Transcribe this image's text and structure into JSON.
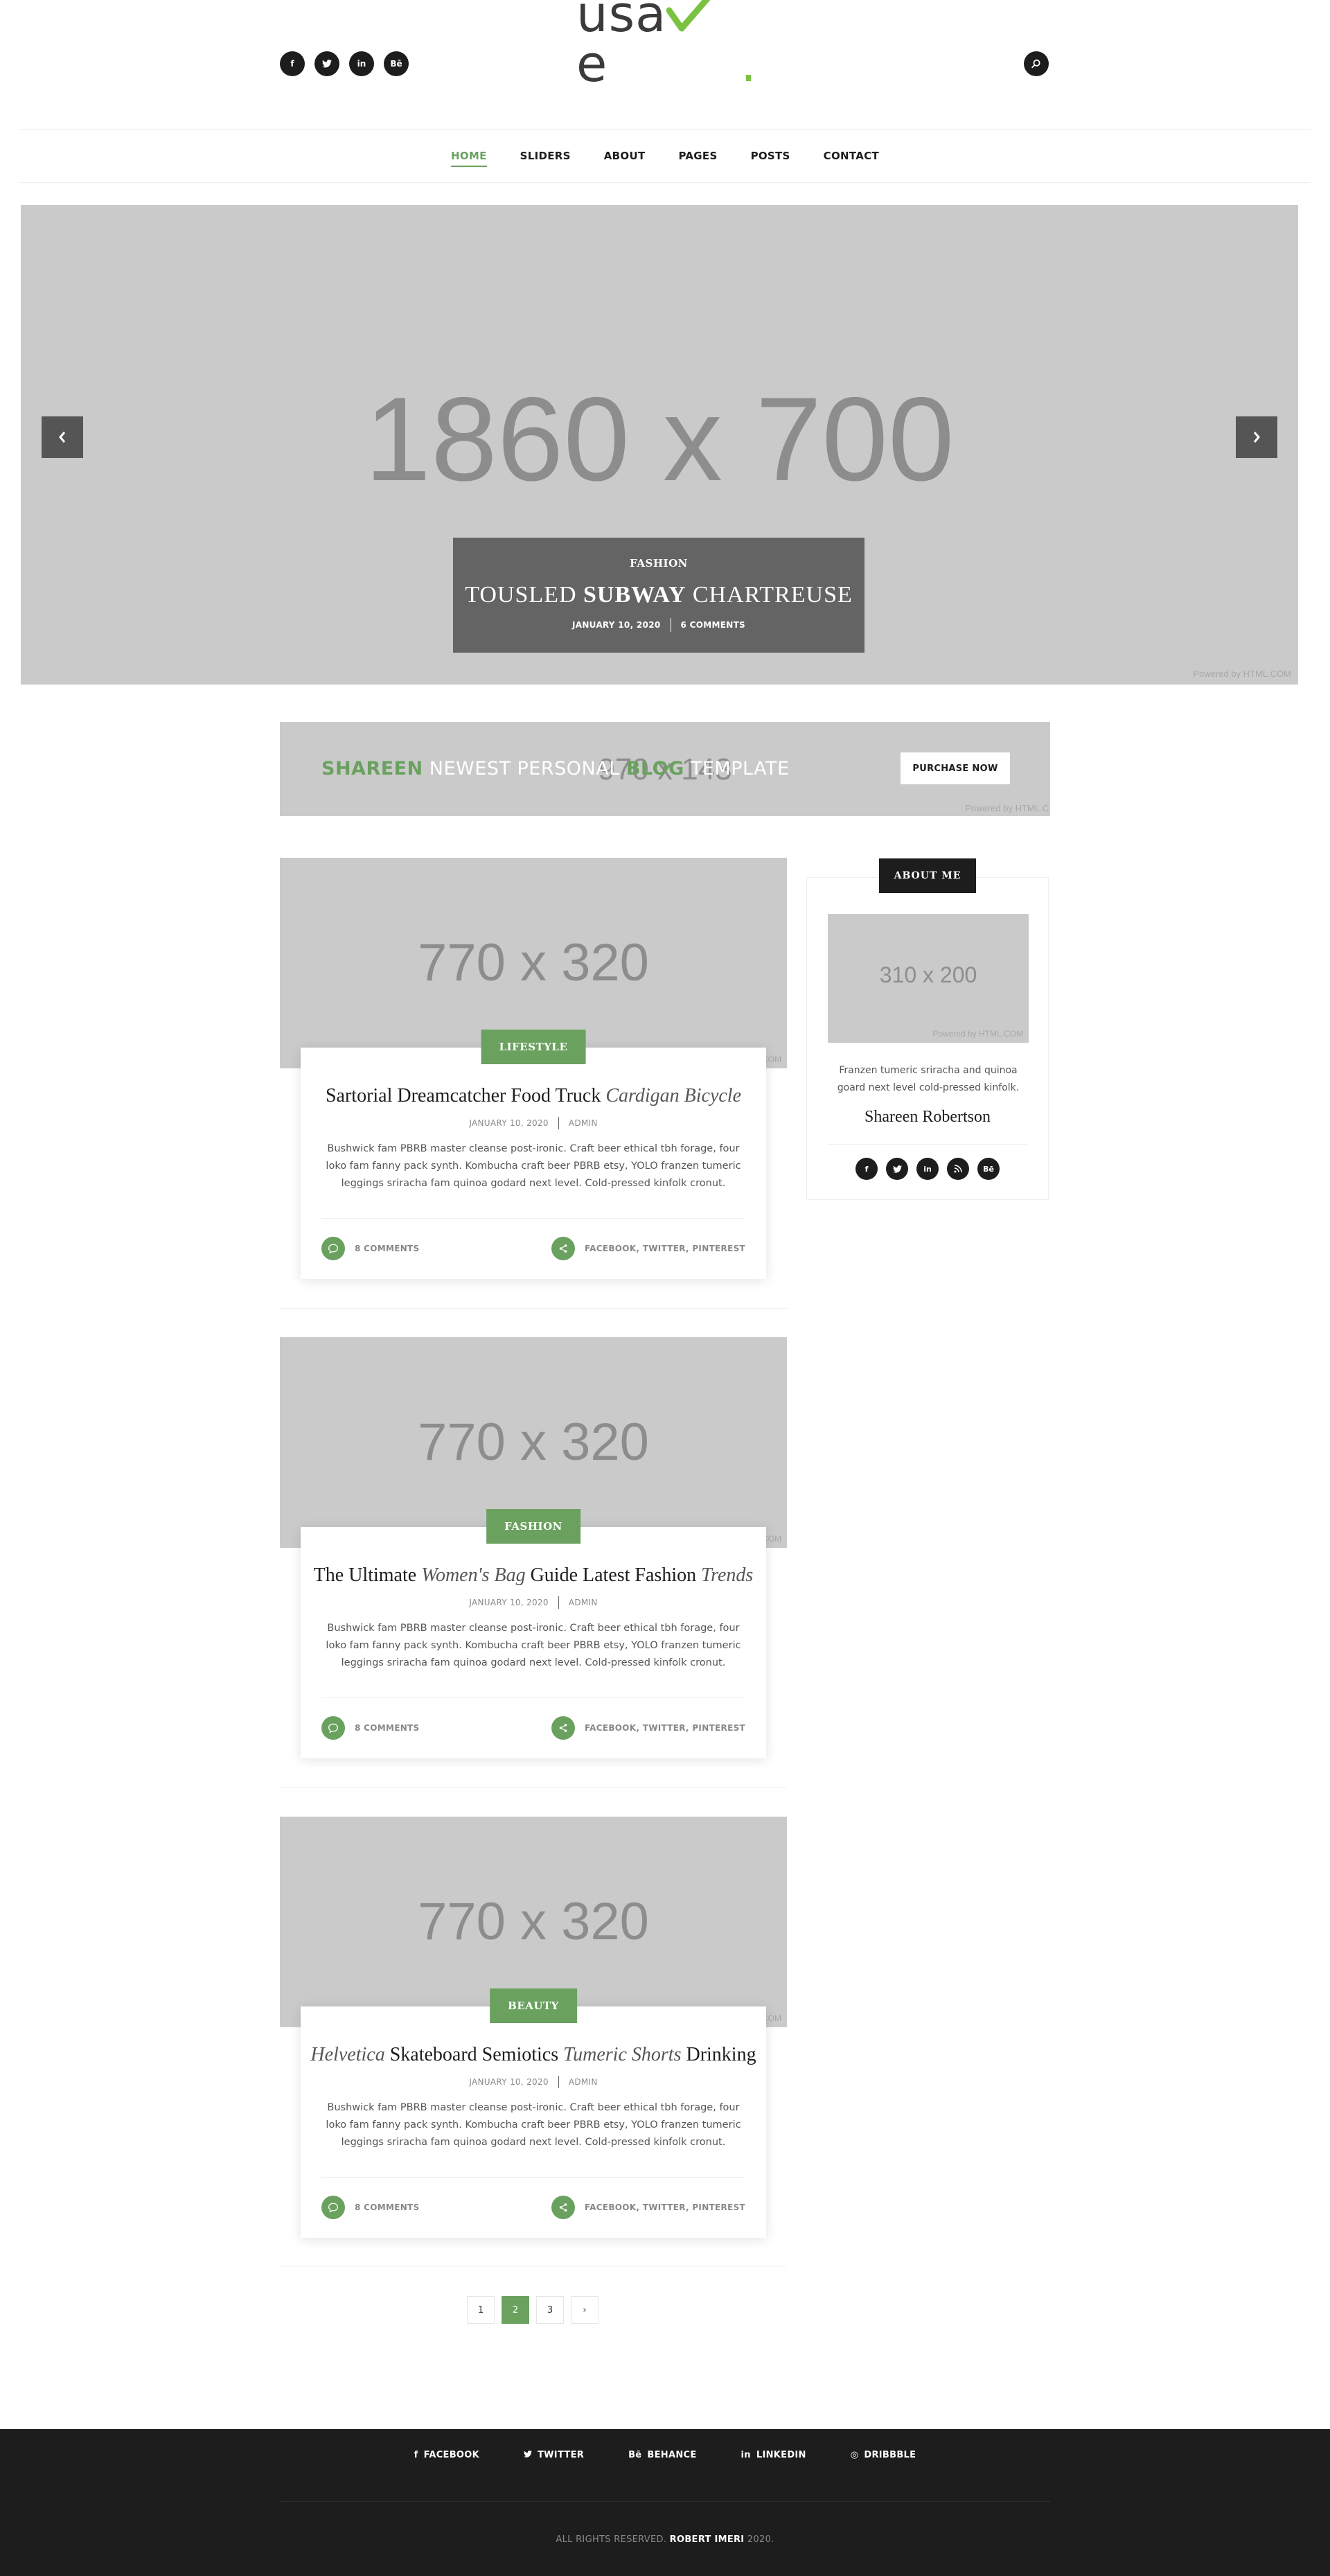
{
  "header": {
    "social": [
      "f",
      "t",
      "in",
      "Bē"
    ],
    "logo": {
      "part1": "usa",
      "check": "v",
      "part2": "e",
      "dot": "."
    },
    "search_icon": "search-icon"
  },
  "nav": {
    "items": [
      {
        "label": "HOME",
        "active": true
      },
      {
        "label": "SLIDERS",
        "active": false
      },
      {
        "label": "ABOUT",
        "active": false
      },
      {
        "label": "PAGES",
        "active": false
      },
      {
        "label": "POSTS",
        "active": false
      },
      {
        "label": "CONTACT",
        "active": false
      }
    ]
  },
  "hero": {
    "placeholder": "1860 x 700",
    "powered": "Powered by HTML.COM",
    "category": "FASHION",
    "title_a": "TOUSLED ",
    "title_b": "SUBWAY",
    "title_c": " CHARTREUSE",
    "date": "JANUARY 10, 2020",
    "comments": "6 COMMENTS"
  },
  "promo": {
    "placeholder": "970 x 143",
    "brand": "SHAREEN",
    "text_a": " NEWEST PERSONAL ",
    "blog": "BLOG",
    "text_b": " TEMPLATE",
    "button": "PURCHASE NOW",
    "powered": "Powered by HTML.C"
  },
  "posts": [
    {
      "placeholder": "770 x 320",
      "powered": "Powered by HTML.COM",
      "category": "LIFESTYLE",
      "title_a": "Sartorial Dreamcatcher Food Truck ",
      "title_i": "Cardigan Bicycle",
      "title_b": "",
      "date": "JANUARY 10, 2020",
      "author": "ADMIN",
      "excerpt": "Bushwick fam PBRB master cleanse post-ironic. Craft beer ethical tbh forage, four loko fam fanny pack synth. Kombucha craft beer PBRB etsy, YOLO franzen tumeric leggings sriracha fam quinoa godard next level. Cold-pressed kinfolk cronut.",
      "comments": "8 COMMENTS",
      "share": "FACEBOOK, TWITTER, PINTEREST"
    },
    {
      "placeholder": "770 x 320",
      "powered": "Powered by HTML.COM",
      "category": "FASHION",
      "title_a": "The Ultimate ",
      "title_i": "Women's Bag",
      "title_b": " Guide Latest Fashion ",
      "title_i2": "Trends",
      "date": "JANUARY 10, 2020",
      "author": "ADMIN",
      "excerpt": "Bushwick fam PBRB master cleanse post-ironic. Craft beer ethical tbh forage, four loko fam fanny pack synth. Kombucha craft beer PBRB etsy, YOLO franzen tumeric leggings sriracha fam quinoa godard next level. Cold-pressed kinfolk cronut.",
      "comments": "8 COMMENTS",
      "share": "FACEBOOK, TWITTER, PINTEREST"
    },
    {
      "placeholder": "770 x 320",
      "powered": "Powered by HTML.COM",
      "category": "BEAUTY",
      "title_i": "Helvetica",
      "title_a": " Skateboard Semiotics ",
      "title_i2": "Tumeric Shorts",
      "title_b": " Drinking",
      "date": "JANUARY 10, 2020",
      "author": "ADMIN",
      "excerpt": "Bushwick fam PBRB master cleanse post-ironic. Craft beer ethical tbh forage, four loko fam fanny pack synth. Kombucha craft beer PBRB etsy, YOLO franzen tumeric leggings sriracha fam quinoa godard next level. Cold-pressed kinfolk cronut.",
      "comments": "8 COMMENTS",
      "share": "FACEBOOK, TWITTER, PINTEREST"
    }
  ],
  "about": {
    "tag": "ABOUT ME",
    "placeholder": "310 x 200",
    "powered": "Powered by HTML.COM",
    "text": "Franzen tumeric sriracha and quinoa goard next level cold-pressed kinfolk.",
    "name": "Shareen Robertson",
    "social": [
      "f",
      "t",
      "in",
      "rss",
      "Bē"
    ]
  },
  "pagination": {
    "pages": [
      "1",
      "2",
      "3",
      "›"
    ],
    "active": "2"
  },
  "footer": {
    "links": [
      {
        "icon": "f",
        "label": "FACEBOOK"
      },
      {
        "icon": "t",
        "label": "TWITTER"
      },
      {
        "icon": "Bē",
        "label": "BEHANCE"
      },
      {
        "icon": "in",
        "label": "LINKEDIN"
      },
      {
        "icon": "◎",
        "label": "DRIBBBLE"
      }
    ],
    "copyright_a": "ALL RIGHTS RESERVED. ",
    "copyright_name": "ROBERT IMERI",
    "copyright_b": " 2020."
  },
  "colors": {
    "accent": "#6aa15f",
    "dark": "#1d1d1d",
    "placeholder": "#cacaca",
    "logo_check": "#7cc242"
  }
}
